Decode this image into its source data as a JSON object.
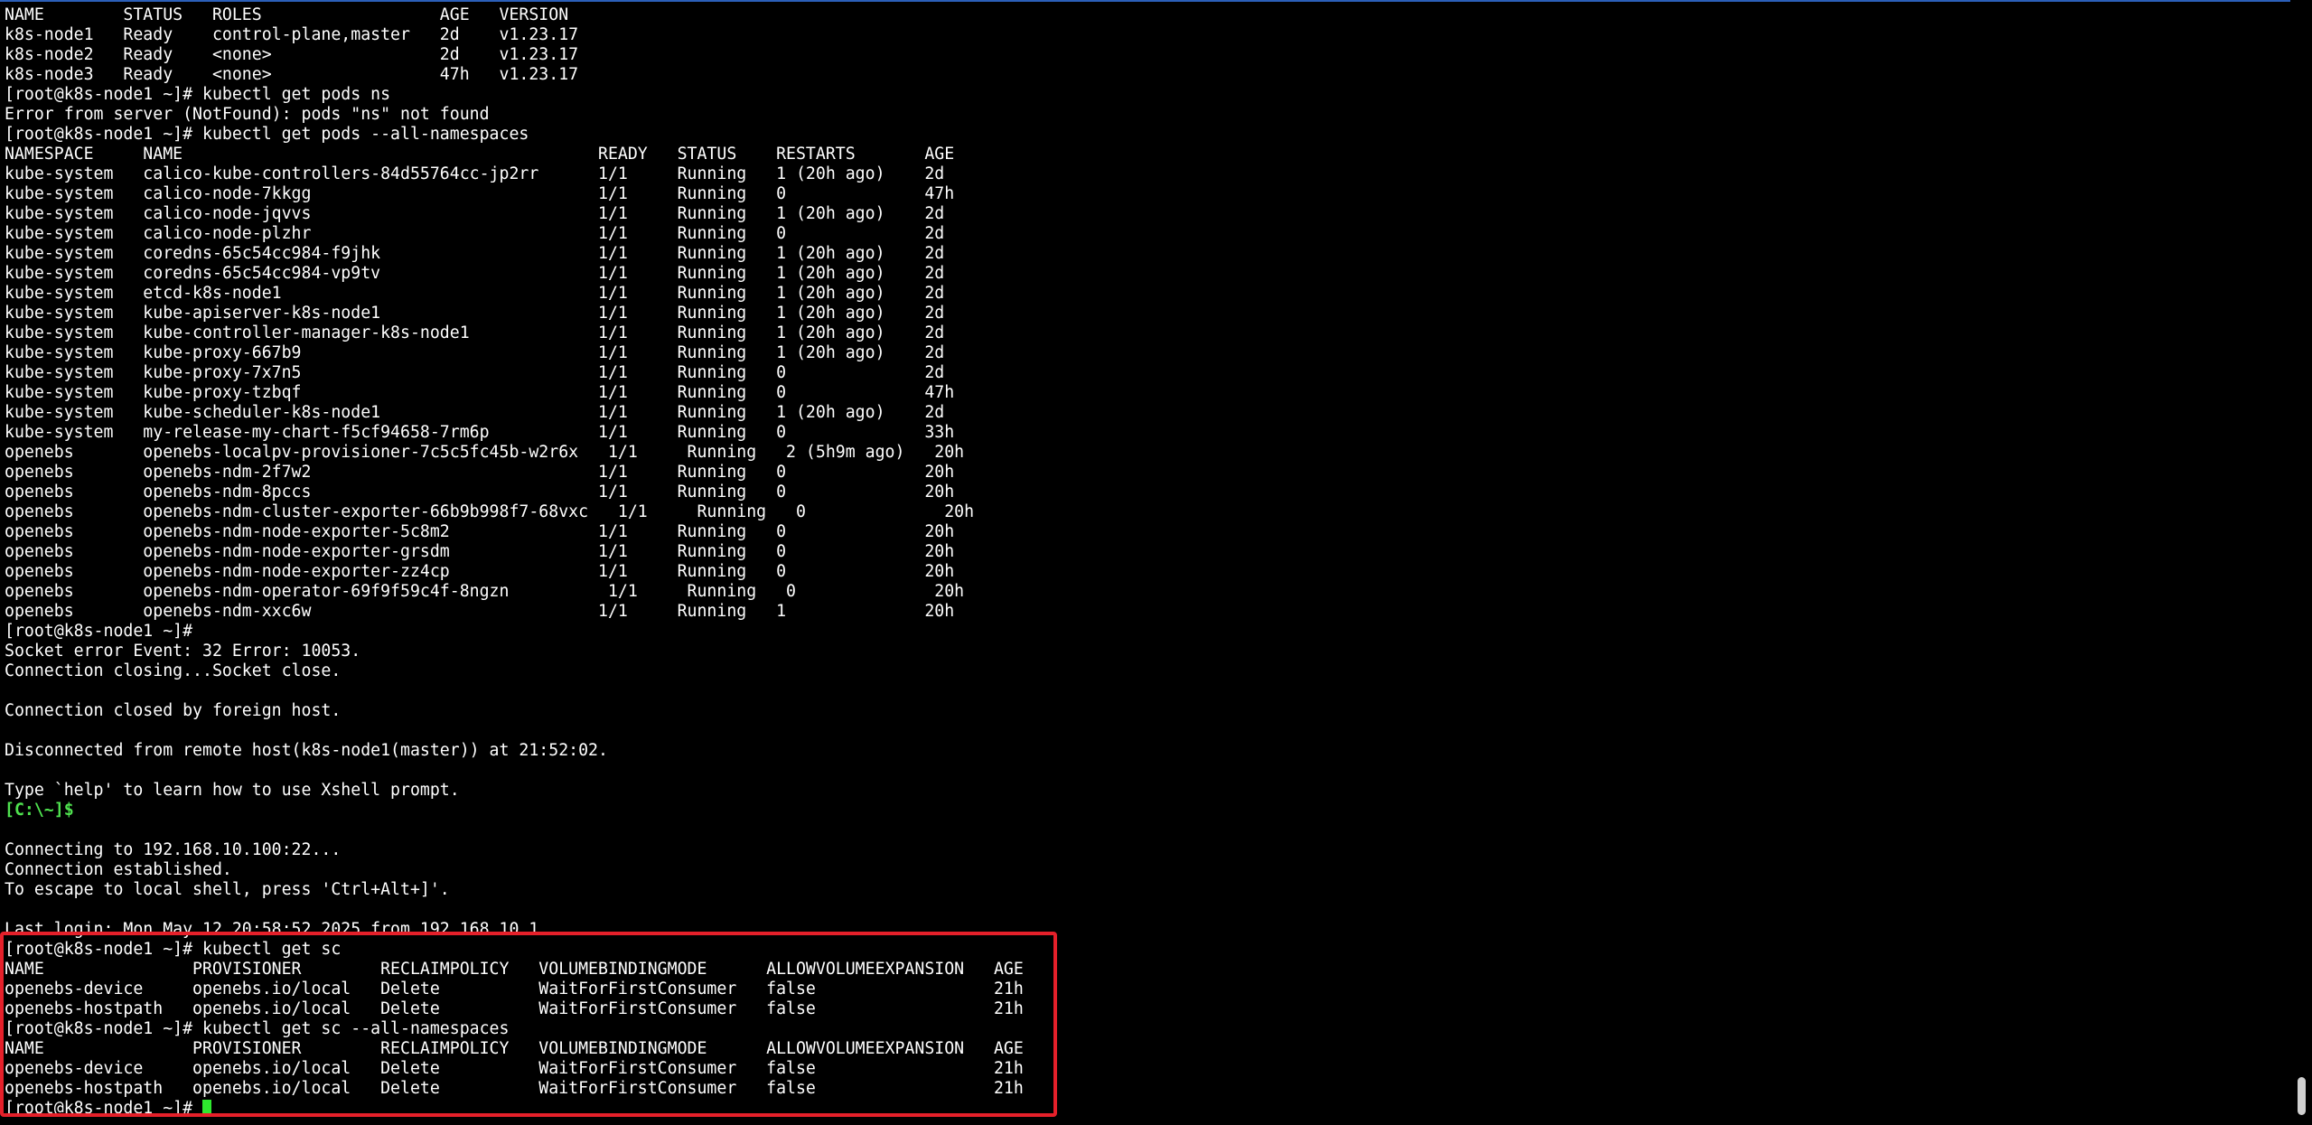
{
  "terminal": {
    "lines": [
      "NAME        STATUS   ROLES                  AGE   VERSION",
      "k8s-node1   Ready    control-plane,master   2d    v1.23.17",
      "k8s-node2   Ready    <none>                 2d    v1.23.17",
      "k8s-node3   Ready    <none>                 47h   v1.23.17",
      "[root@k8s-node1 ~]# kubectl get pods ns",
      "Error from server (NotFound): pods \"ns\" not found",
      "[root@k8s-node1 ~]# kubectl get pods --all-namespaces",
      "NAMESPACE     NAME                                          READY   STATUS    RESTARTS       AGE",
      "kube-system   calico-kube-controllers-84d55764cc-jp2rr      1/1     Running   1 (20h ago)    2d",
      "kube-system   calico-node-7kkgg                             1/1     Running   0              47h",
      "kube-system   calico-node-jqvvs                             1/1     Running   1 (20h ago)    2d",
      "kube-system   calico-node-plzhr                             1/1     Running   0              2d",
      "kube-system   coredns-65c54cc984-f9jhk                      1/1     Running   1 (20h ago)    2d",
      "kube-system   coredns-65c54cc984-vp9tv                      1/1     Running   1 (20h ago)    2d",
      "kube-system   etcd-k8s-node1                                1/1     Running   1 (20h ago)    2d",
      "kube-system   kube-apiserver-k8s-node1                      1/1     Running   1 (20h ago)    2d",
      "kube-system   kube-controller-manager-k8s-node1             1/1     Running   1 (20h ago)    2d",
      "kube-system   kube-proxy-667b9                              1/1     Running   1 (20h ago)    2d",
      "kube-system   kube-proxy-7x7n5                              1/1     Running   0              2d",
      "kube-system   kube-proxy-tzbqf                              1/1     Running   0              47h",
      "kube-system   kube-scheduler-k8s-node1                      1/1     Running   1 (20h ago)    2d",
      "kube-system   my-release-my-chart-f5cf94658-7rm6p           1/1     Running   0              33h",
      "openebs       openebs-localpv-provisioner-7c5c5fc45b-w2r6x   1/1     Running   2 (5h9m ago)   20h",
      "openebs       openebs-ndm-2f7w2                             1/1     Running   0              20h",
      "openebs       openebs-ndm-8pccs                             1/1     Running   0              20h",
      "openebs       openebs-ndm-cluster-exporter-66b9b998f7-68vxc   1/1     Running   0              20h",
      "openebs       openebs-ndm-node-exporter-5c8m2               1/1     Running   0              20h",
      "openebs       openebs-ndm-node-exporter-grsdm               1/1     Running   0              20h",
      "openebs       openebs-ndm-node-exporter-zz4cp               1/1     Running   0              20h",
      "openebs       openebs-ndm-operator-69f9f59c4f-8ngzn          1/1     Running   0              20h",
      "openebs       openebs-ndm-xxc6w                             1/1     Running   1              20h",
      "[root@k8s-node1 ~]#",
      "Socket error Event: 32 Error: 10053.",
      "Connection closing...Socket close.",
      "",
      "Connection closed by foreign host.",
      "",
      "Disconnected from remote host(k8s-node1(master)) at 21:52:02.",
      "",
      "Type `help' to learn how to use Xshell prompt.",
      "[C:\\~]$",
      "",
      "Connecting to 192.168.10.100:22...",
      "Connection established.",
      "To escape to local shell, press 'Ctrl+Alt+]'.",
      "",
      "Last login: Mon May 12 20:58:52 2025 from 192.168.10.1",
      "[root@k8s-node1 ~]# kubectl get sc",
      "NAME               PROVISIONER        RECLAIMPOLICY   VOLUMEBINDINGMODE      ALLOWVOLUMEEXPANSION   AGE",
      "openebs-device     openebs.io/local   Delete          WaitForFirstConsumer   false                  21h",
      "openebs-hostpath   openebs.io/local   Delete          WaitForFirstConsumer   false                  21h",
      "[root@k8s-node1 ~]# kubectl get sc --all-namespaces",
      "NAME               PROVISIONER        RECLAIMPOLICY   VOLUMEBINDINGMODE      ALLOWVOLUMEEXPANSION   AGE",
      "openebs-device     openebs.io/local   Delete          WaitForFirstConsumer   false                  21h",
      "openebs-hostpath   openebs.io/local   Delete          WaitForFirstConsumer   false                  21h",
      "[root@k8s-node1 ~]# "
    ],
    "local_prompt_line": "[C:\\~]$",
    "colors": {
      "background": "#000000",
      "text": "#ffffff",
      "local_prompt": "#4fe24f",
      "cursor": "#2ee82e",
      "highlight_box": "#e5202a"
    }
  }
}
